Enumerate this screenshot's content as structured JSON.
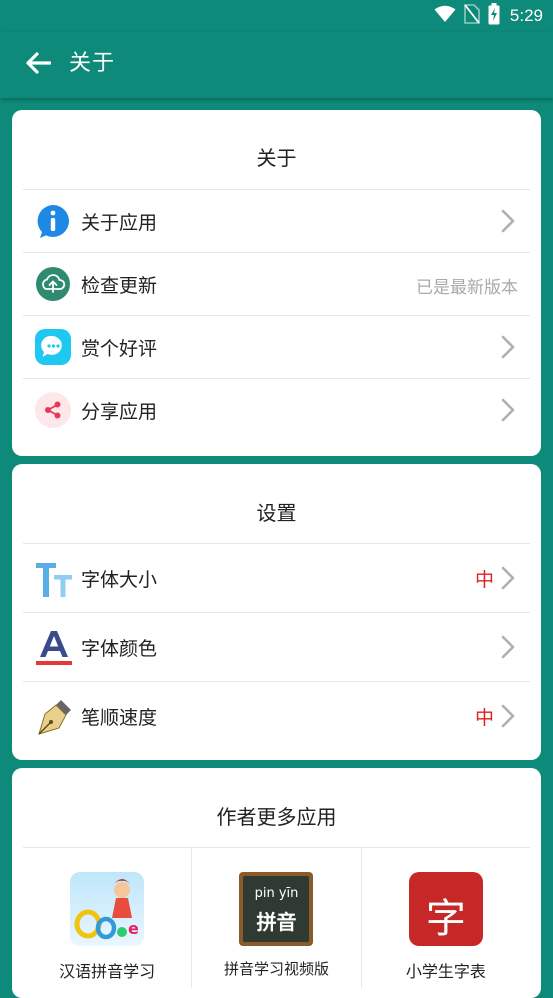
{
  "status_bar": {
    "time": "5:29",
    "icons": [
      "wifi-icon",
      "no-sim-icon",
      "battery-charging-icon"
    ]
  },
  "app_bar": {
    "title": "关于",
    "back_icon": "arrow-left-icon"
  },
  "about_section": {
    "title": "关于",
    "items": [
      {
        "label": "关于应用",
        "icon": "info-icon",
        "value": ""
      },
      {
        "label": "检查更新",
        "icon": "cloud-upload-icon",
        "value": "已是最新版本"
      },
      {
        "label": "赏个好评",
        "icon": "chat-bubble-icon",
        "value": ""
      },
      {
        "label": "分享应用",
        "icon": "share-icon",
        "value": ""
      }
    ]
  },
  "settings_section": {
    "title": "设置",
    "items": [
      {
        "label": "字体大小",
        "icon": "font-size-icon",
        "value": "中"
      },
      {
        "label": "字体颜色",
        "icon": "font-color-icon",
        "value": ""
      },
      {
        "label": "笔顺速度",
        "icon": "pen-icon",
        "value": "中"
      }
    ]
  },
  "more_apps_section": {
    "title": "作者更多应用",
    "apps": [
      {
        "name": "汉语拼音学习",
        "icon": "pinyin-app-icon"
      },
      {
        "name": "拼音学习视频版",
        "icon": "pinyin-video-app-icon",
        "icon_text_top": "pin yīn",
        "icon_text_main": "拼音"
      },
      {
        "name": "小学生字表",
        "icon": "character-table-app-icon",
        "icon_text_main": "字"
      }
    ]
  },
  "colors": {
    "primary": "#0e8a7a",
    "value_red": "#e02020",
    "value_gray": "#aaaaaa",
    "chevron": "#b0b0b0"
  }
}
